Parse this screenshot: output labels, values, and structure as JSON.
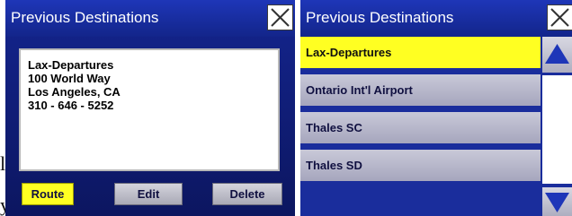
{
  "background_text": {
    "fragment_1": "l",
    "fragment_2": "y"
  },
  "left_panel": {
    "title": "Previous Destinations",
    "close_icon": "close-icon",
    "address": {
      "line1": "Lax-Departures",
      "line2": "100 World Way",
      "line3": "Los Angeles, CA",
      "line4": "310 - 646 - 5252"
    },
    "buttons": {
      "route": "Route",
      "edit": "Edit",
      "delete": "Delete"
    },
    "selected_button": "Route"
  },
  "right_panel": {
    "title": "Previous Destinations",
    "close_icon": "close-icon",
    "items": [
      {
        "label": "Lax-Departures",
        "selected": true
      },
      {
        "label": "Ontario Int'l Airport",
        "selected": false
      },
      {
        "label": "Thales SC",
        "selected": false
      },
      {
        "label": "Thales SD",
        "selected": false
      }
    ],
    "scroll_up_icon": "triangle-up-icon",
    "scroll_down_icon": "triangle-down-icon"
  },
  "colors": {
    "panel_blue": "#1a2d9c",
    "selected_yellow": "#ffff22",
    "button_gray": "#b8b8c6",
    "arrow_blue": "#1e36b8"
  }
}
